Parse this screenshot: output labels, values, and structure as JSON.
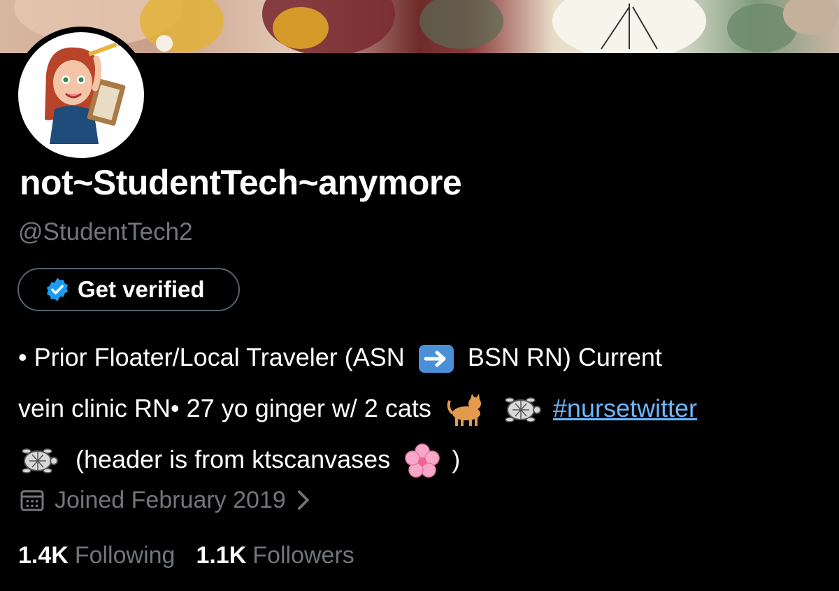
{
  "profile": {
    "display_name": "not~StudentTech~anymore",
    "handle": "@StudentTech2",
    "verify_label": "Get verified",
    "bio": {
      "line1_a": "• Prior Floater/Local Traveler (ASN",
      "line1_b": "BSN RN) Current",
      "line2_a": "vein clinic RN• 27 yo ginger w/ 2 cats",
      "hashtag": "#nursetwitter",
      "line3_a": "(header is from ktscanvases",
      "line3_b": ")"
    },
    "joined": "Joined February 2019",
    "following_count": "1.4K",
    "following_label": "Following",
    "followers_count": "1.1K",
    "followers_label": "Followers"
  },
  "icons": [
    "avatar-memoji",
    "verified-badge-icon",
    "right-arrow-emoji",
    "cat-emoji",
    "turtle-emoji",
    "cherry-blossom-emoji",
    "calendar-icon",
    "chevron-right-icon"
  ],
  "colors": {
    "background": "#000000",
    "text": "#ffffff",
    "muted": "#71767b",
    "link": "#6cb7ff",
    "verify_blue": "#1d9bf0"
  }
}
